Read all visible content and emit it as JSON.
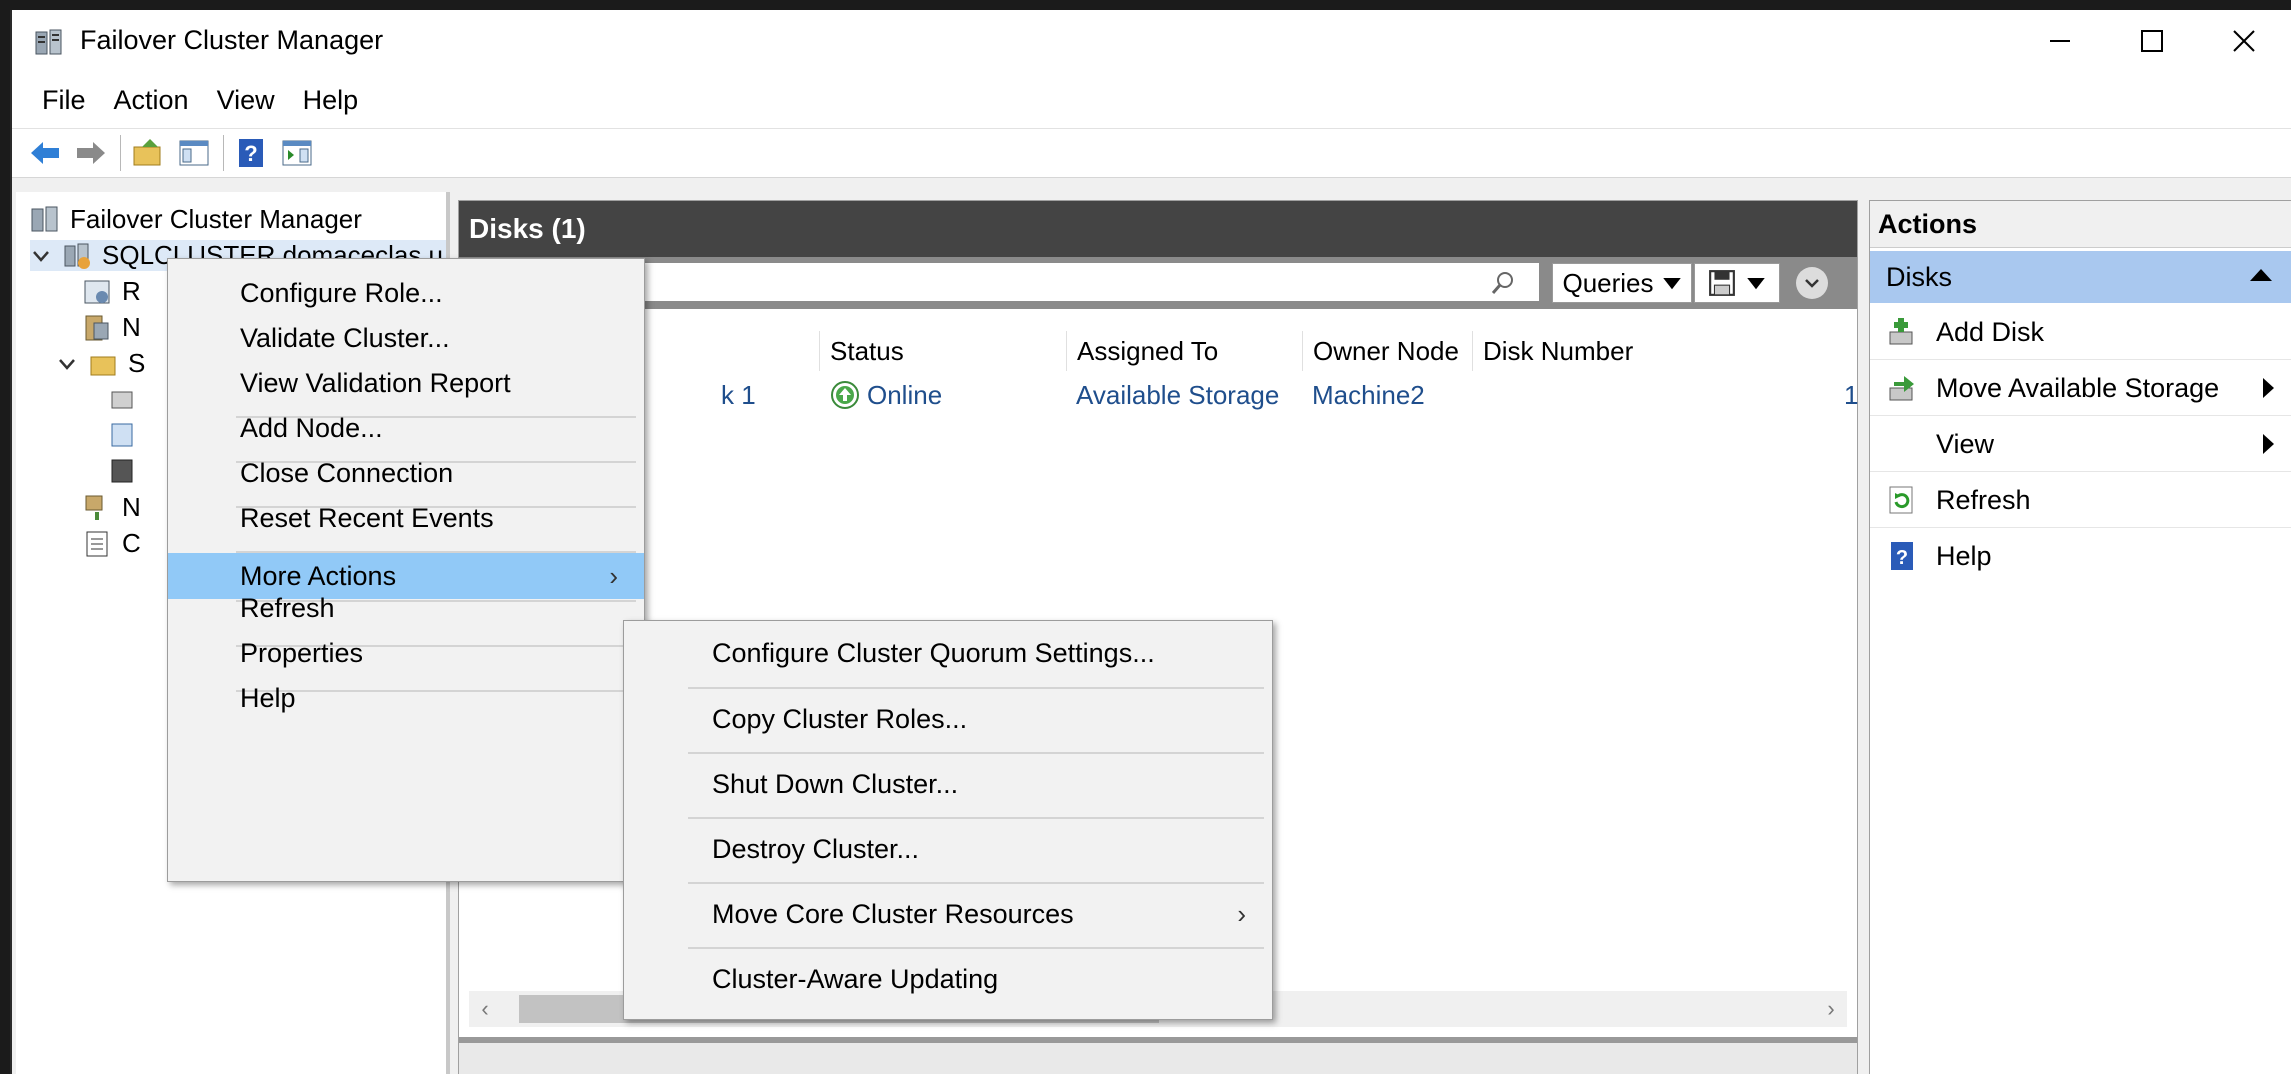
{
  "window": {
    "title": "Failover Cluster Manager"
  },
  "menubar": [
    "File",
    "Action",
    "View",
    "Help"
  ],
  "tree": {
    "root": "Failover Cluster Manager",
    "cluster": "SQLCLUSTER.domaceclas.u",
    "partial": {
      "roles_letter": "R",
      "nodes_letter": "N",
      "storage_letter": "S",
      "networks_letter": "N",
      "events_letter": "C"
    }
  },
  "center": {
    "header": "Disks (1)",
    "queries_label": "Queries",
    "columns": [
      "Status",
      "Assigned To",
      "Owner Node",
      "Disk Number"
    ],
    "row": {
      "name_tail": "k 1",
      "status": "Online",
      "assigned_to": "Available Storage",
      "owner_node": "Machine2",
      "disk_number_tail": "1"
    }
  },
  "actions": {
    "header": "Actions",
    "section": "Disks",
    "items": [
      {
        "label": "Add Disk",
        "icon": "add-disk-icon"
      },
      {
        "label": "Move Available Storage",
        "icon": "move-storage-icon",
        "submenu": true
      },
      {
        "label": "View",
        "icon": "",
        "submenu": true
      },
      {
        "label": "Refresh",
        "icon": "refresh-icon"
      },
      {
        "label": "Help",
        "icon": "help-icon"
      }
    ]
  },
  "context_menu": {
    "items": [
      "Configure Role...",
      "Validate Cluster...",
      "View Validation Report",
      "Add Node...",
      "Close Connection",
      "Reset Recent Events",
      "More Actions",
      "Refresh",
      "Properties",
      "Help"
    ],
    "highlighted": "More Actions"
  },
  "submenu": {
    "items": [
      "Configure Cluster Quorum Settings...",
      "Copy Cluster Roles...",
      "Shut Down Cluster...",
      "Destroy Cluster...",
      "Move Core Cluster Resources",
      "Cluster-Aware Updating"
    ]
  },
  "colors": {
    "highlight": "#91c9f7",
    "section": "#a9c8ef",
    "header_dark": "#444444",
    "link": "#1f4e8c"
  }
}
